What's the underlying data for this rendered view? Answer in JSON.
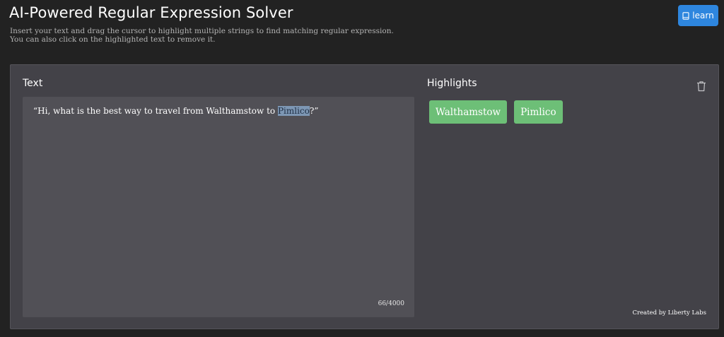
{
  "header": {
    "title": "AI-Powered Regular Expression Solver",
    "subtitle_line1": "Insert your text and drag the cursor to highlight multiple strings to find matching regular expression.",
    "subtitle_line2": "You can also click on the highlighted text to remove it.",
    "learn_label": "learn",
    "learn_icon": "book-icon",
    "learn_color": "#2e86de"
  },
  "text_section": {
    "heading": "Text",
    "content_before": "“Hi, what is the best way to travel from Walthamstow to ",
    "content_selected": "Pimlico",
    "content_after": "?”",
    "char_count": "66/4000"
  },
  "highlights_section": {
    "heading": "Highlights",
    "clear_icon": "trash-icon",
    "chips": [
      "Walthamstow",
      "Pimlico"
    ],
    "chip_color": "#6dbf77"
  },
  "footer": {
    "credit": "Created by Liberty Labs"
  }
}
